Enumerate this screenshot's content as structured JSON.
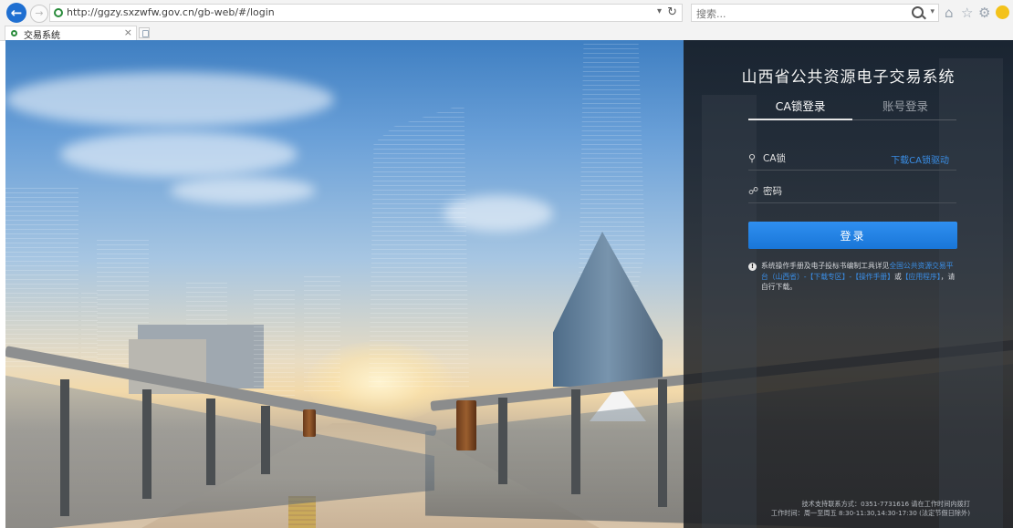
{
  "browser": {
    "url": "http://ggzy.sxzwfw.gov.cn/gb-web/#/login",
    "search_placeholder": "搜索...",
    "tab_title": "交易系统",
    "tab_close": "×",
    "icons": [
      "back-icon",
      "forward-icon",
      "refresh-icon",
      "search-icon",
      "home-icon",
      "star-icon",
      "gear-icon",
      "smiley-icon"
    ]
  },
  "login": {
    "system_title": "山西省公共资源电子交易系统",
    "tabs": [
      {
        "label": "CA锁登录",
        "active": true
      },
      {
        "label": "账号登录",
        "active": false
      }
    ],
    "ca_field": {
      "placeholder": "CA锁",
      "icon": "key-icon"
    },
    "driver_link": "下载CA锁驱动",
    "password_field": {
      "placeholder": "密码",
      "icon": "lock-icon"
    },
    "login_button": "登录",
    "notice": {
      "prefix": "系统操作手册及电子投标书编制工具详见",
      "link1": "全国公共资源交易平台（山西省）-【下载专区】-【操作手册】",
      "middle": "或",
      "link2": "【应用程序】",
      "suffix": "，请自行下载。"
    },
    "footer": {
      "support": "技术支持联系方式：0351-7731616 请在工作时间内拨打",
      "hours": "工作时间：周一至周五 8:30-11:30,14:30-17:30 (法定节假日除外)"
    }
  },
  "colors": {
    "accent": "#1976d8",
    "link": "#3a8ee6",
    "panel": "#18191d"
  }
}
